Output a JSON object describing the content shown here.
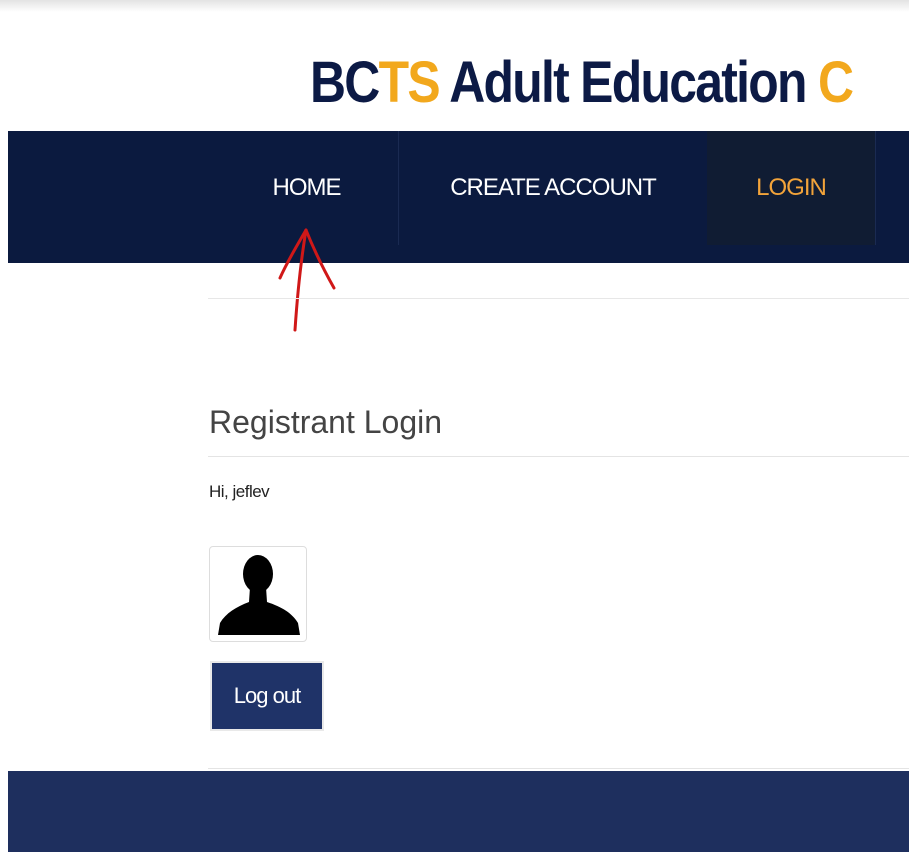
{
  "header": {
    "title_part1": "BC",
    "title_part2": "TS",
    "title_part3": " Adult Education ",
    "title_part4": "C"
  },
  "nav": {
    "items": [
      {
        "label": "HOME"
      },
      {
        "label": "CREATE ACCOUNT"
      },
      {
        "label": "LOGIN"
      }
    ]
  },
  "main": {
    "section_title": "Registrant Login",
    "greeting": "Hi, jeflev",
    "logout_label": "Log out"
  },
  "annotation": {
    "arrow_color": "#d01818",
    "arrow_target": "HOME"
  },
  "colors": {
    "navy": "#0b1a3f",
    "accent_orange": "#f2a81d",
    "button_blue": "#1f3368",
    "footer_blue": "#1e2f5e"
  }
}
